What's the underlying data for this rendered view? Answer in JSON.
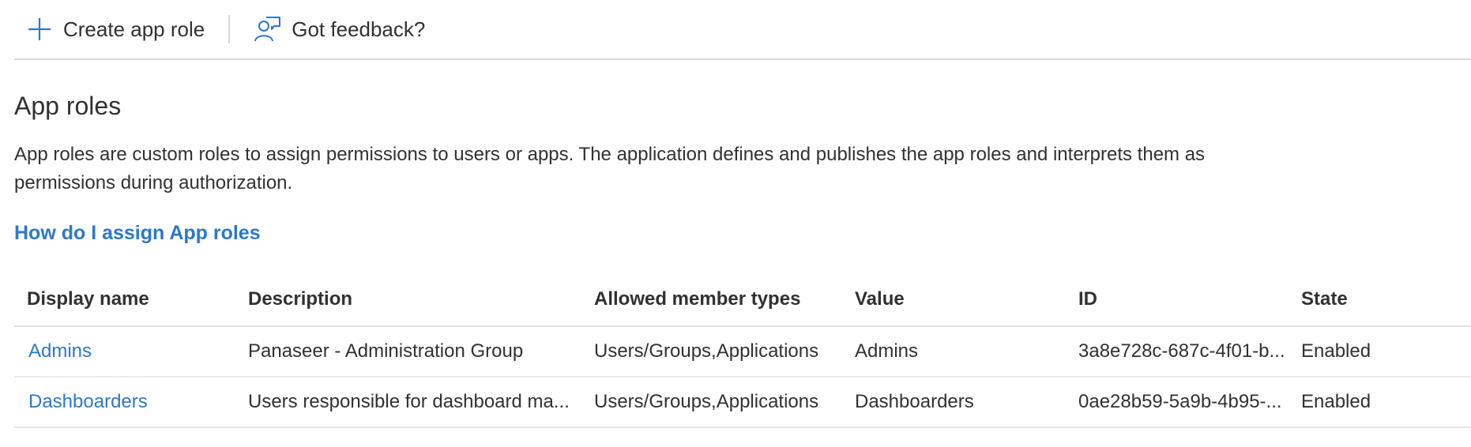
{
  "toolbar": {
    "create_label": "Create app role",
    "feedback_label": "Got feedback?"
  },
  "icons": {
    "create": "plus-icon",
    "feedback": "feedback-person-icon"
  },
  "colors": {
    "link": "#2d78c8",
    "text": "#323130",
    "divider": "#d6d6d6"
  },
  "page": {
    "title": "App roles",
    "description": "App roles are custom roles to assign permissions to users or apps. The application defines and publishes the app roles and interprets them as permissions during authorization.",
    "help_link": "How do I assign App roles"
  },
  "table": {
    "columns": [
      "Display name",
      "Description",
      "Allowed member types",
      "Value",
      "ID",
      "State"
    ],
    "rows": [
      {
        "display_name": "Admins",
        "description": "Panaseer - Administration Group",
        "member_types": "Users/Groups,Applications",
        "value": "Admins",
        "id": "3a8e728c-687c-4f01-b...",
        "state": "Enabled"
      },
      {
        "display_name": "Dashboarders",
        "description": "Users responsible for dashboard ma...",
        "member_types": "Users/Groups,Applications",
        "value": "Dashboarders",
        "id": "0ae28b59-5a9b-4b95-...",
        "state": "Enabled"
      }
    ]
  }
}
